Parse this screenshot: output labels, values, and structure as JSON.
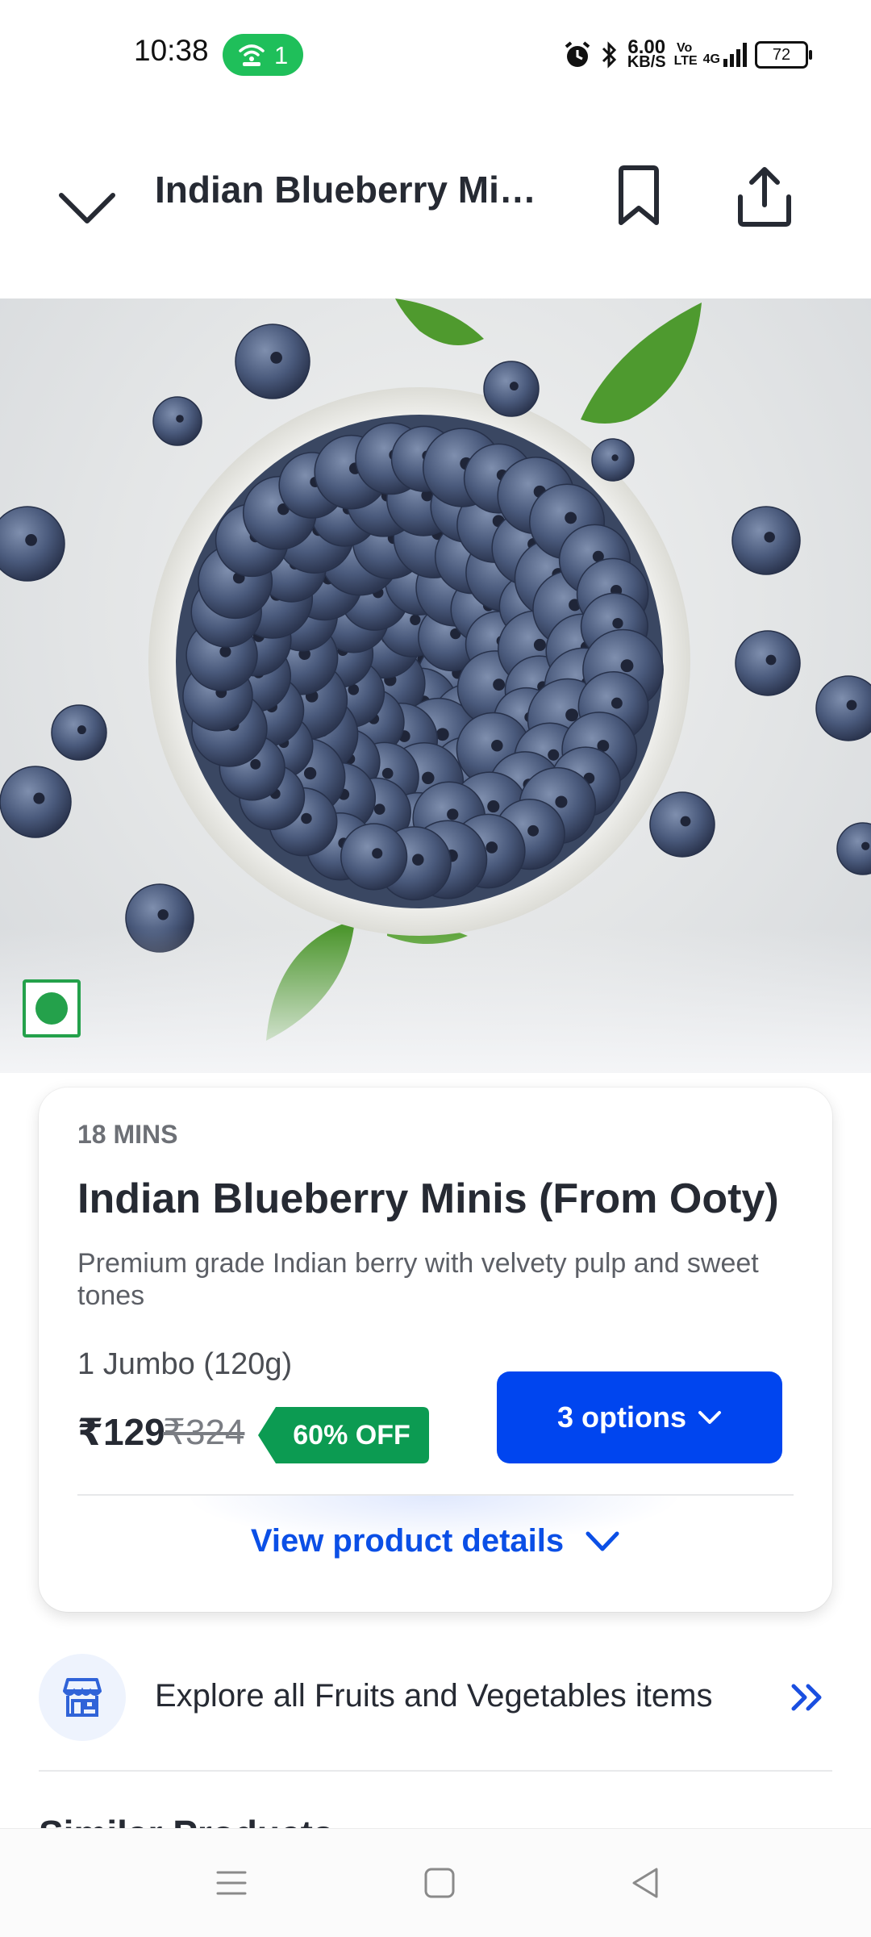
{
  "status_bar": {
    "time": "10:38",
    "hotspot_count": "1",
    "net_speed_value": "6.00",
    "net_speed_unit": "KB/S",
    "network_label": "4G",
    "volte_label": "Vo LTE",
    "battery": "72"
  },
  "header": {
    "title": "Indian Blueberry Minis (From Ooty)",
    "icons": [
      "chevron-down-icon",
      "bookmark-icon",
      "share-icon"
    ]
  },
  "product": {
    "eta": "18 MINS",
    "name": "Indian Blueberry Minis (From Ooty)",
    "description": "Premium grade Indian berry with velvety pulp and sweet tones",
    "quantity": "1 Jumbo (120g)",
    "price": "₹129",
    "mrp": "₹324",
    "discount": "60% OFF",
    "options_label": "3 options",
    "view_details_label": "View product details",
    "veg": true
  },
  "explore": {
    "label": "Explore all Fruits and Vegetables items",
    "icon": "store-icon"
  },
  "similar_products": {
    "title": "Similar Products"
  },
  "nav_bar": {
    "buttons": [
      "menu-icon",
      "home-icon",
      "back-icon"
    ]
  },
  "colors": {
    "accent_blue": "#0045ef",
    "discount_green": "#0c9b52",
    "hotspot_green": "#1fbf5a",
    "veg_green": "#24a14b"
  }
}
